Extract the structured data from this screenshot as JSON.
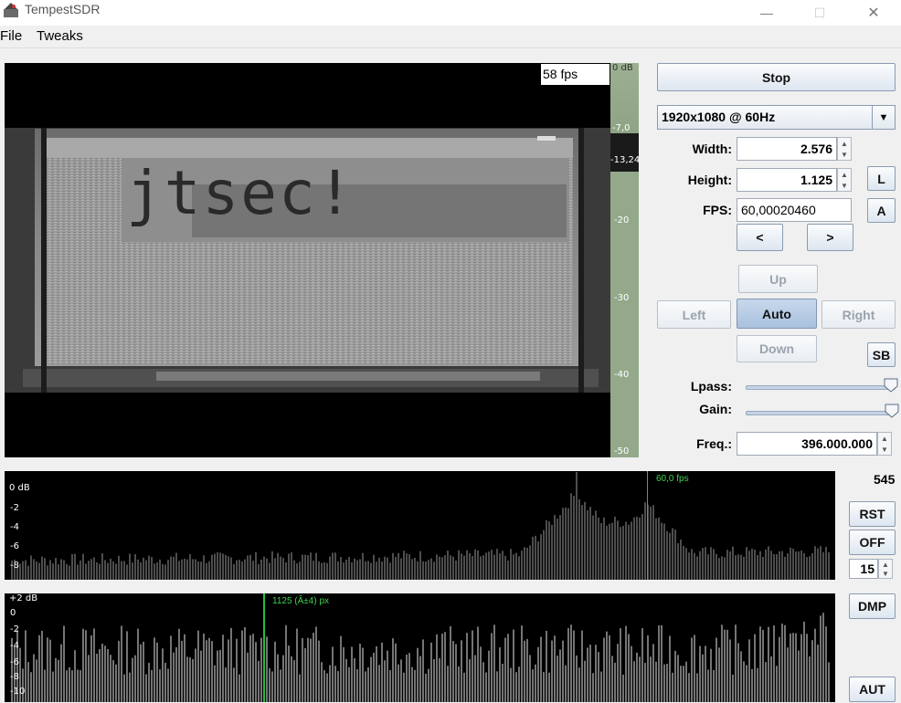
{
  "window": {
    "title": "TempestSDR",
    "minimize": "—",
    "maximize": "☐",
    "close": "✕"
  },
  "menu": [
    {
      "label": "File"
    },
    {
      "label": "Tweaks"
    }
  ],
  "video": {
    "fps": "58 fps",
    "text": "jtsec!"
  },
  "db_scale": {
    "ticks": [
      "0 dB",
      "-7,0",
      "-13,24",
      "-20",
      "-30",
      "-40",
      "-50"
    ]
  },
  "controls": {
    "stop": "Stop",
    "resolution": "1920x1080 @ 60Hz",
    "width_label": "Width:",
    "width_value": "2.576",
    "height_label": "Height:",
    "height_value": "1.125",
    "fps_label": "FPS:",
    "fps_value": "60,00020460",
    "l_button": "L",
    "a_button": "A",
    "prev": "<",
    "next": ">",
    "up": "Up",
    "left": "Left",
    "auto": "Auto",
    "right": "Right",
    "down": "Down",
    "sb": "SB",
    "lpass_label": "Lpass:",
    "lpass_level": 0.98,
    "gain_label": "Gain:",
    "gain_level": 0.99,
    "freq_label": "Freq.:",
    "freq_value": "396.000.000"
  },
  "fps_plot": {
    "marker_label": "60,0 fps",
    "ticks": [
      "0 dB",
      "-2",
      "-4",
      "-6",
      "-8"
    ],
    "counter": "545",
    "rst": "RST",
    "off": "OFF",
    "spin_value": "15"
  },
  "px_plot": {
    "marker_label": "1125 (Â±4) px",
    "ticks": [
      "+2 dB",
      "0",
      "-2",
      "-4",
      "-6",
      "-8",
      "-10"
    ],
    "dmp": "DMP",
    "aut": "AUT"
  }
}
